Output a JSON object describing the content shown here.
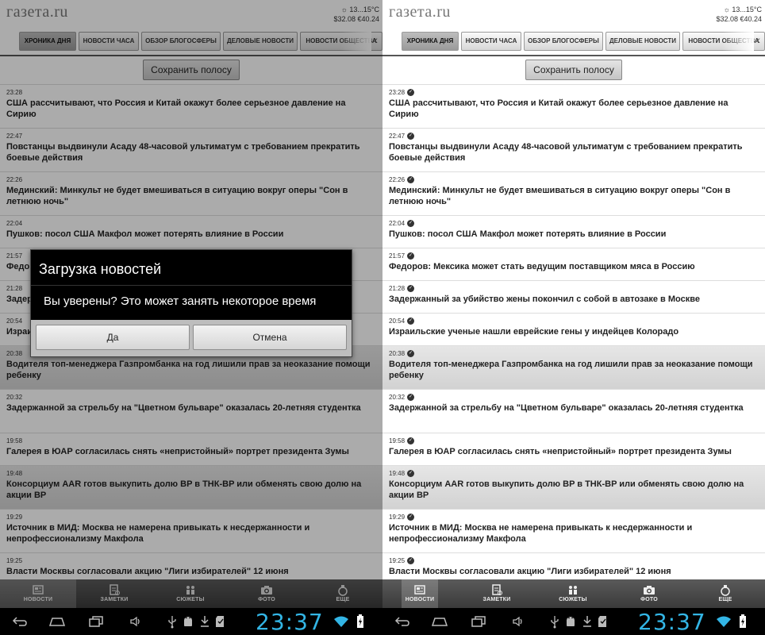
{
  "header": {
    "logo": "газета.ru",
    "weather": "13...15°C",
    "rates": "$32.08 €40.24"
  },
  "tabs": [
    {
      "label": "ХРОНИКА ДНЯ",
      "active": true
    },
    {
      "label": "НОВОСТИ ЧАСА"
    },
    {
      "label": "ОБЗОР БЛОГОСФЕРЫ"
    },
    {
      "label": "ДЕЛОВЫЕ НОВОСТИ"
    },
    {
      "label": "НОВОСТИ ОБЩЕСТВА"
    }
  ],
  "save_button": "Сохранить полосу",
  "news": [
    {
      "time": "23:28",
      "title": "США рассчитывают, что Россия и Китай окажут более серьезное давление на Сирию"
    },
    {
      "time": "22:47",
      "title": "Повстанцы выдвинули Асаду 48-часовой ультиматум с требованием прекратить боевые действия"
    },
    {
      "time": "22:26",
      "title": "Мединский: Минкульт не будет вмешиваться в ситуацию вокруг оперы \"Сон в летнюю ночь\""
    },
    {
      "time": "22:04",
      "title": "Пушков: посол США Макфол может потерять влияние в России"
    },
    {
      "time": "21:57",
      "title": "Федоров: Мексика может стать ведущим поставщиком мяса в Россию"
    },
    {
      "time": "21:28",
      "title": "Задержанный за убийство жены покончил с собой в автозаке в Москве"
    },
    {
      "time": "20:54",
      "title": "Израильские ученые нашли еврейские гены у индейцев Колорадо"
    },
    {
      "time": "20:38",
      "title": "Водителя топ-менеджера Газпромбанка на год лишили прав за неоказание помощи ребенку"
    },
    {
      "time": "20:32",
      "title": "Задержанной за стрельбу на \"Цветном бульваре\" оказалась 20-летняя студентка"
    },
    {
      "time": "19:58",
      "title": "Галерея в ЮАР согласилась снять «непристойный» портрет президента Зумы"
    },
    {
      "time": "19:48",
      "title": "Консорциум AAR готов выкупить долю BP в ТНК-BP или обменять свою долю на акции BP"
    },
    {
      "time": "19:29",
      "title": "Источник в МИД: Москва не намерена привыкать к несдержанности и непрофессионализму Макфола"
    },
    {
      "time": "19:25",
      "title": "Власти Москвы согласовали акцию \"Лиги избирателей\" 12 июня"
    }
  ],
  "bottom_nav": [
    {
      "label": "НОВОСТИ",
      "icon": "news-icon"
    },
    {
      "label": "ЗАМЕТКИ",
      "icon": "notes-icon"
    },
    {
      "label": "СЮЖЕТЫ",
      "icon": "stories-icon"
    },
    {
      "label": "ФОТО",
      "icon": "camera-icon"
    },
    {
      "label": "ЕЩЕ",
      "icon": "more-icon"
    }
  ],
  "system": {
    "clock": "23:37"
  },
  "dialog": {
    "title": "Загрузка новостей",
    "message": "Вы уверены? Это может занять некоторое время",
    "ok": "Да",
    "cancel": "Отмена"
  },
  "colors": {
    "clock": "#33b5e5",
    "accent_bar": "#555555"
  }
}
